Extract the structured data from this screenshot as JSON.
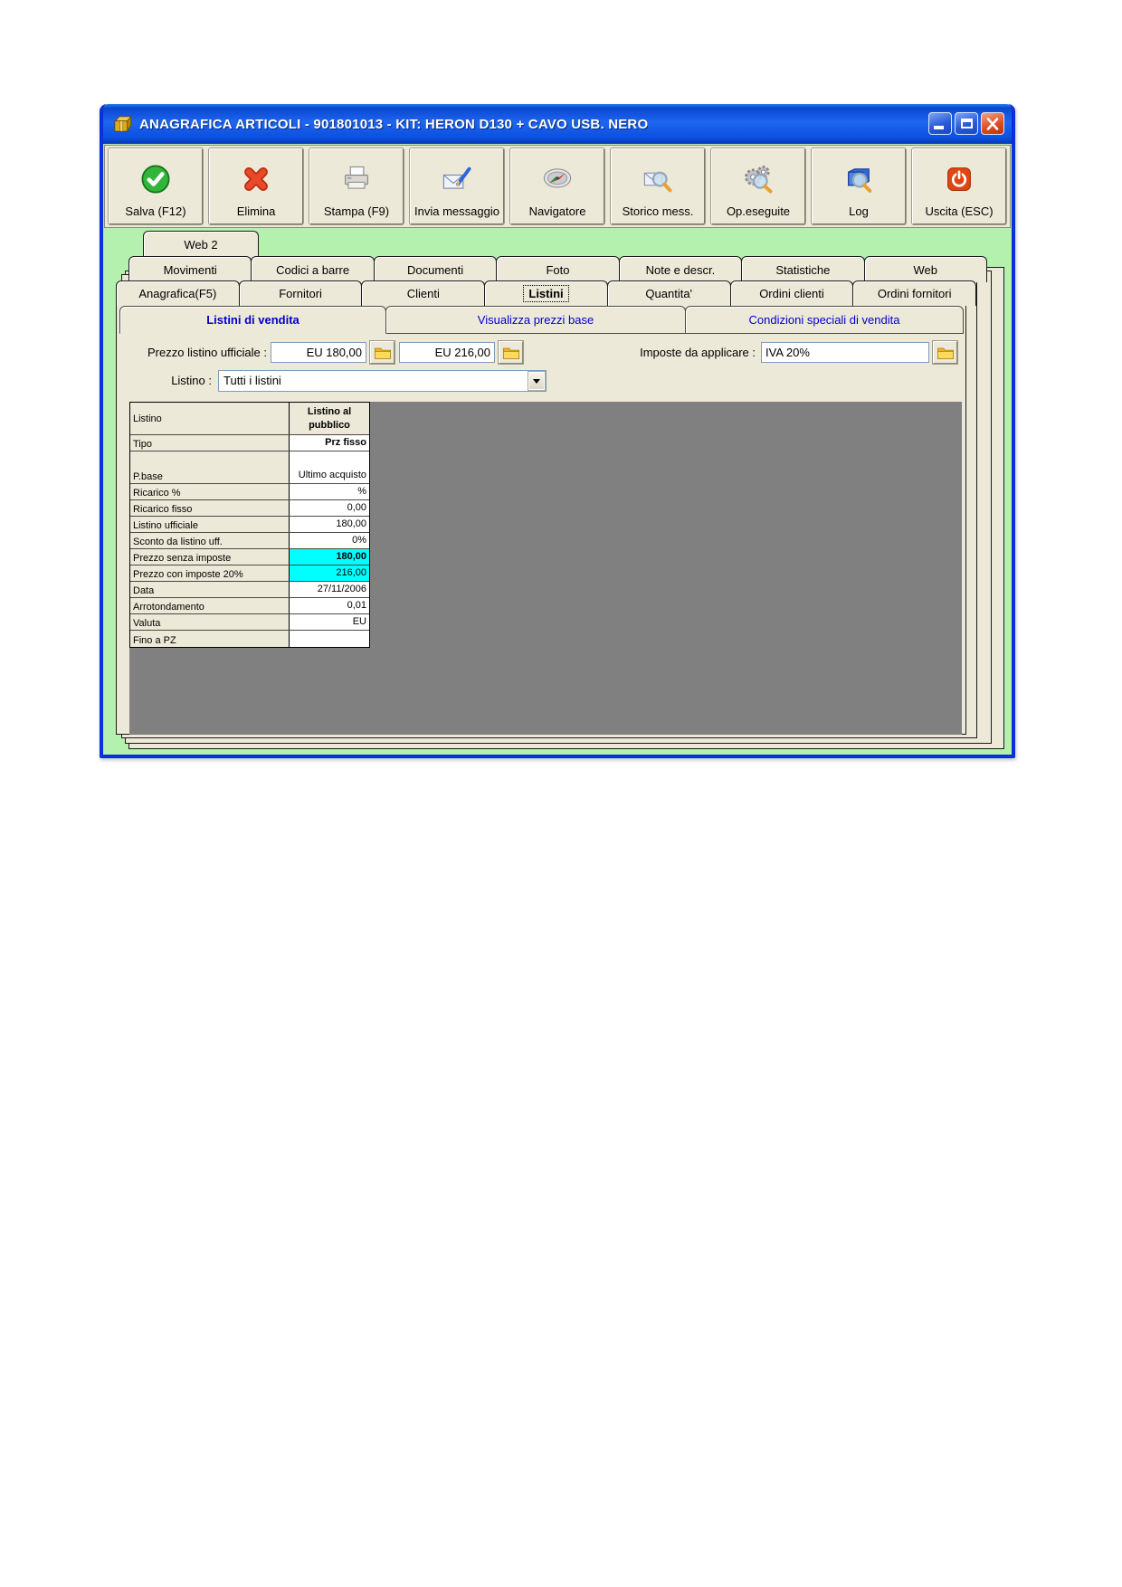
{
  "window": {
    "title": "ANAGRAFICA ARTICOLI - 901801013 - KIT: HERON D130 + CAVO USB. NERO",
    "app_icon": "package-icon",
    "control_icons": [
      "minimize-icon",
      "maximize-icon",
      "close-icon"
    ]
  },
  "toolbar": {
    "buttons": [
      {
        "label": "Salva (F12)",
        "icon": "save-check-icon"
      },
      {
        "label": "Elimina",
        "icon": "delete-x-icon"
      },
      {
        "label": "Stampa (F9)",
        "icon": "printer-icon"
      },
      {
        "label": "Invia messaggio",
        "icon": "envelope-pen-icon"
      },
      {
        "label": "Navigatore",
        "icon": "compass-icon"
      },
      {
        "label": "Storico mess.",
        "icon": "envelope-magnifier-icon"
      },
      {
        "label": "Op.eseguite",
        "icon": "gears-magnifier-icon"
      },
      {
        "label": "Log",
        "icon": "book-magnifier-icon"
      },
      {
        "label": "Uscita (ESC)",
        "icon": "power-icon"
      }
    ]
  },
  "tabs": {
    "row_top": [
      "Web 2"
    ],
    "row_middle": [
      "Movimenti",
      "Codici a barre",
      "Documenti",
      "Foto",
      "Note e descr.",
      "Statistiche",
      "Web"
    ],
    "row_bottom": [
      "Anagrafica(F5)",
      "Fornitori",
      "Clienti",
      "Listini",
      "Quantita'",
      "Ordini clienti",
      "Ordini fornitori"
    ],
    "active_tab": "Listini"
  },
  "subtabs": [
    "Listini di vendita",
    "Visualizza prezzi base",
    "Condizioni speciali di vendita"
  ],
  "form": {
    "prezzo_label": "Prezzo listino ufficiale :",
    "prezzo_value_1": "EU 180,00",
    "prezzo_value_2": "EU 216,00",
    "imposte_label": "Imposte da applicare :",
    "imposte_value": "IVA 20%",
    "listino_label": "Listino :",
    "listino_value": "Tutti i listini",
    "folder_icon": "folder-icon"
  },
  "table": {
    "header": {
      "col1": "Listino",
      "col2": "Listino al pubblico"
    },
    "rows": [
      {
        "label": "Tipo",
        "value": "Prz fisso",
        "highlight": false,
        "bold": true
      },
      {
        "label": "P.base",
        "value": "Ultimo acquisto",
        "highlight": false,
        "bold": false
      },
      {
        "label": "Ricarico %",
        "value": "%",
        "highlight": false,
        "bold": false
      },
      {
        "label": "Ricarico fisso",
        "value": "0,00",
        "highlight": false,
        "bold": false
      },
      {
        "label": "Listino ufficiale",
        "value": "180,00",
        "highlight": false,
        "bold": false
      },
      {
        "label": "Sconto da listino uff.",
        "value": "0%",
        "highlight": false,
        "bold": false
      },
      {
        "label": "Prezzo senza imposte",
        "value": "180,00",
        "highlight": true,
        "bold": true
      },
      {
        "label": "Prezzo con imposte 20%",
        "value": "216,00",
        "highlight": true,
        "bold": false
      },
      {
        "label": "Data",
        "value": "27/11/2006",
        "highlight": false,
        "bold": false
      },
      {
        "label": "Arrotondamento",
        "value": "0,01",
        "highlight": false,
        "bold": false
      },
      {
        "label": "Valuta",
        "value": "EU",
        "highlight": false,
        "bold": false
      },
      {
        "label": "Fino a PZ",
        "value": "",
        "highlight": false,
        "bold": false
      }
    ]
  },
  "colors": {
    "titlebar_blue": "#0B50DE",
    "window_border": "#0831D9",
    "content_green": "#B4F0AE",
    "panel_beige": "#ECE9D8",
    "table_gray": "#808080",
    "highlight_cyan": "#00FFFF",
    "subtab_text_blue": "#0000CE",
    "close_button_red": "#E05028"
  }
}
